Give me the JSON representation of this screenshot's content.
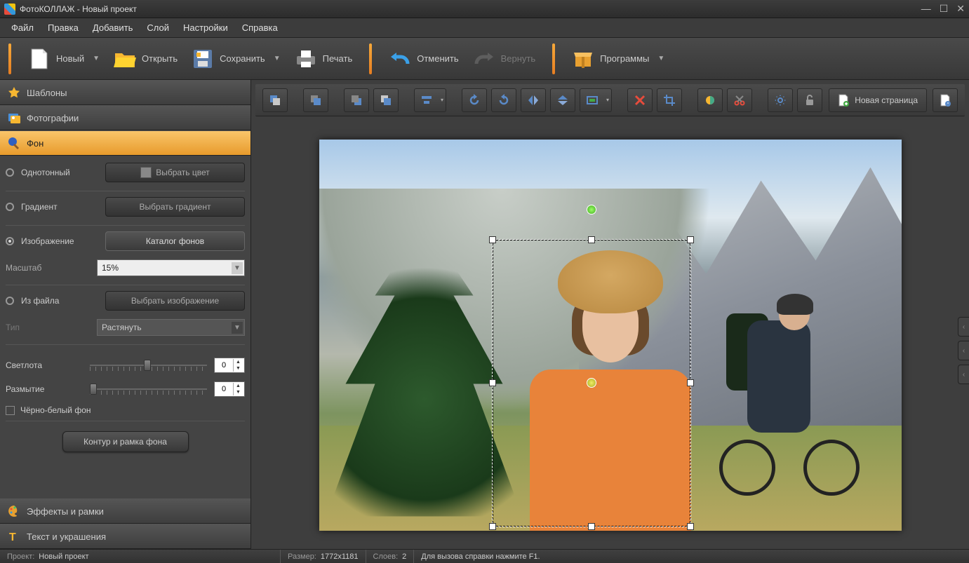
{
  "title": "ФотоКОЛЛАЖ - Новый проект",
  "menu": {
    "file": "Файл",
    "edit": "Правка",
    "add": "Добавить",
    "layer": "Слой",
    "settings": "Настройки",
    "help": "Справка"
  },
  "toolbar": {
    "new": "Новый",
    "open": "Открыть",
    "save": "Сохранить",
    "print": "Печать",
    "undo": "Отменить",
    "redo": "Вернуть",
    "programs": "Программы"
  },
  "sidebar": {
    "templates": "Шаблоны",
    "photos": "Фотографии",
    "background": "Фон",
    "effects": "Эффекты и рамки",
    "text": "Текст и украшения"
  },
  "bg_panel": {
    "solid": "Однотонный",
    "choose_color": "Выбрать цвет",
    "gradient": "Градиент",
    "choose_gradient": "Выбрать градиент",
    "image": "Изображение",
    "catalog": "Каталог фонов",
    "scale": "Масштаб",
    "scale_value": "15%",
    "from_file": "Из файла",
    "choose_image": "Выбрать изображение",
    "type": "Тип",
    "type_value": "Растянуть",
    "brightness": "Светлота",
    "brightness_value": "0",
    "blur": "Размытие",
    "blur_value": "0",
    "bw": "Чёрно-белый фон",
    "frame_btn": "Контур и рамка фона"
  },
  "canvas_tb": {
    "new_page": "Новая страница"
  },
  "status": {
    "project_k": "Проект:",
    "project_v": "Новый проект",
    "size_k": "Размер:",
    "size_v": "1772x1181",
    "layers_k": "Слоев:",
    "layers_v": "2",
    "help": "Для вызова справки нажмите F1."
  }
}
